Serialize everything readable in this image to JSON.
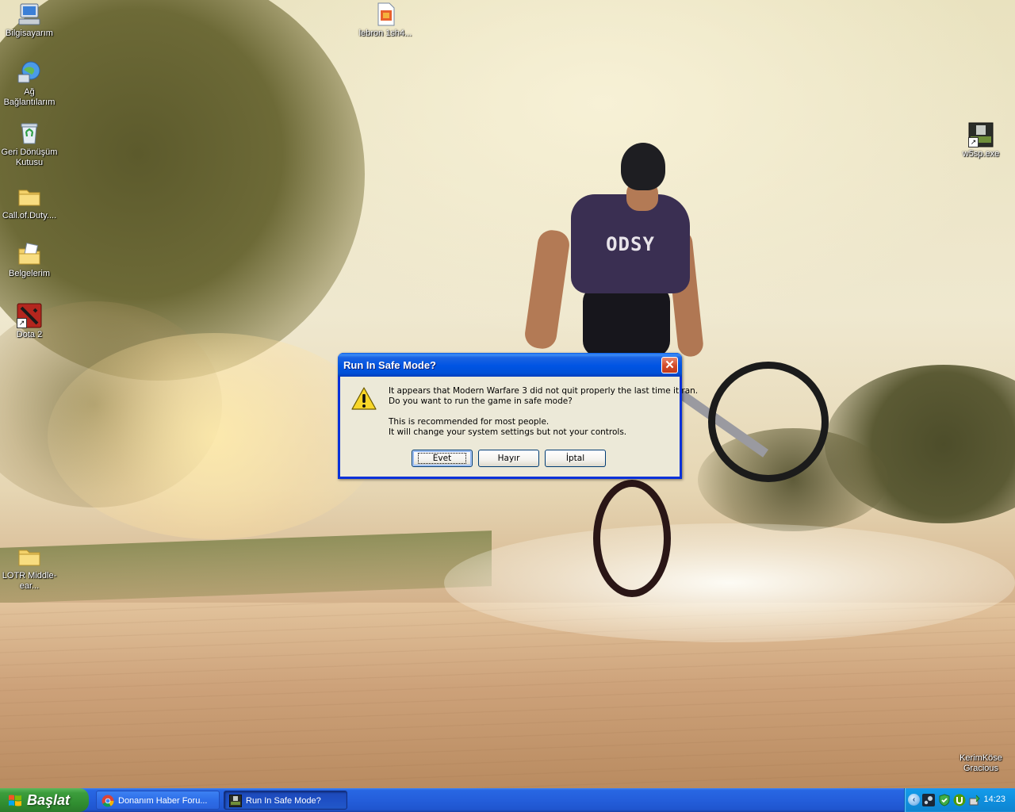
{
  "desktop": {
    "icons": [
      {
        "label": "Bilgisayarım",
        "icon": "my-computer-icon"
      },
      {
        "label": "Ağ Bağlantılarım",
        "icon": "network-connections-icon"
      },
      {
        "label": "Geri Dönüşüm Kutusu",
        "icon": "recycle-bin-icon"
      },
      {
        "label": "Call.of.Duty....",
        "icon": "folder-icon"
      },
      {
        "label": "Belgelerim",
        "icon": "my-documents-icon"
      },
      {
        "label": "Dota 2",
        "icon": "dota2-shortcut-icon"
      },
      {
        "label": "LOTR Middle-ear...",
        "icon": "folder-icon"
      },
      {
        "label": "lebron 1sh4...",
        "icon": "image-file-icon"
      },
      {
        "label": "w5sp.exe",
        "icon": "mw3-shortcut-icon"
      }
    ],
    "wallpaper_shirt_text": "ODSY",
    "watermark": {
      "line1": "KerimKöse",
      "line2": "Gracious"
    }
  },
  "dialog": {
    "title": "Run In Safe Mode?",
    "close_symbol": "✕",
    "icon": "warning-icon",
    "message_line1": "It appears that Modern Warfare 3 did not quit properly the last time it ran.",
    "message_line2": "Do you want to run the game in safe mode?",
    "message_line3": "This is recommended for most people.",
    "message_line4": "It will change your system settings but not your controls.",
    "buttons": {
      "yes": "Evet",
      "no": "Hayır",
      "cancel": "İptal"
    }
  },
  "taskbar": {
    "start_label": "Başlat",
    "tasks": [
      {
        "label": "Donanım Haber Foru...",
        "icon": "chrome-icon",
        "active": false
      },
      {
        "label": "Run In Safe Mode?",
        "icon": "mw3-icon",
        "active": true
      }
    ],
    "tray_expand_symbol": "‹",
    "clock": "14:23"
  },
  "colors": {
    "titlebar_blue": "#0054e3",
    "dialog_face": "#ece9d8",
    "start_green": "#3c9d3c",
    "tray_blue": "#0f8fde"
  }
}
